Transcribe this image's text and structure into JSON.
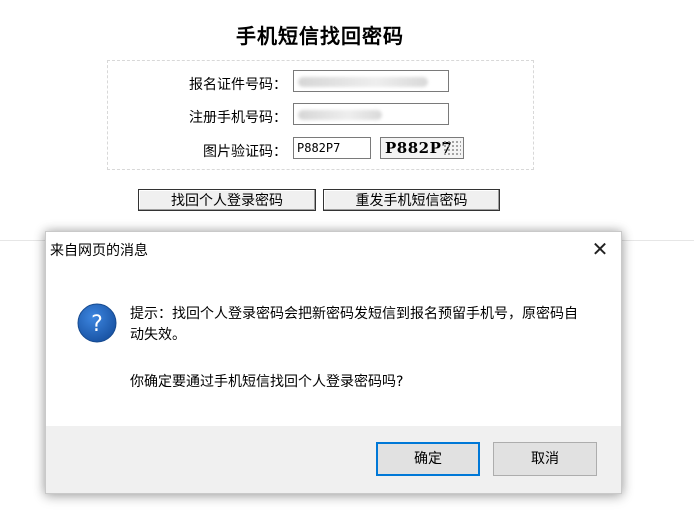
{
  "form": {
    "title": "手机短信找回密码",
    "id_label": "报名证件号码：",
    "phone_label": "注册手机号码：",
    "captcha_label": "图片验证码：",
    "captcha_value": "P882P7",
    "captcha_image_text": "P882P7",
    "retrieve_button": "找回个人登录密码",
    "resend_button": "重发手机短信密码"
  },
  "dialog": {
    "title": "来自网页的消息",
    "close_icon": "close-icon",
    "question_icon": "question-icon",
    "icon_color": "#1e5fb8",
    "message": "提示：找回个人登录密码会把新密码发短信到报名预留手机号，原密码自动失效。",
    "question": "你确定要通过手机短信找回个人登录密码吗?",
    "ok_label": "确定",
    "cancel_label": "取消",
    "accent_color": "#0078d7"
  }
}
